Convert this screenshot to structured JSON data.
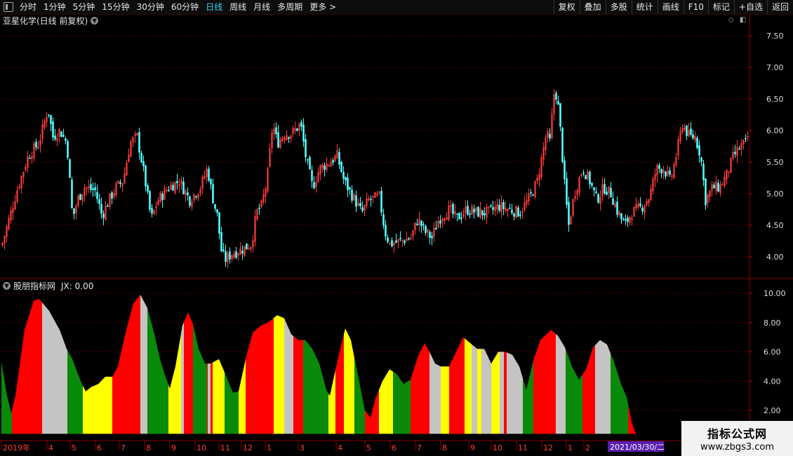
{
  "toolbar": {
    "left_items": [
      "分时",
      "1分钟",
      "5分钟",
      "15分钟",
      "30分钟",
      "60分钟",
      "日线",
      "周线",
      "月线",
      "多周期",
      "更多 >"
    ],
    "active": "日线",
    "right_items": [
      "复权",
      "叠加",
      "多股",
      "统计",
      "画线",
      "F10",
      "标记",
      "+自选",
      "返回"
    ]
  },
  "main_title": "亚星化学(日线 前复权)",
  "sub_title": "股朋指标网",
  "sub_value": "JX: 0.00",
  "price_axis": [
    "7.50",
    "7.00",
    "6.50",
    "6.00",
    "5.50",
    "5.00",
    "4.50",
    "4.00"
  ],
  "ind_axis": [
    "10.00",
    "8.00",
    "6.00",
    "4.00",
    "2.00"
  ],
  "date_labels": [
    "2019年",
    "4",
    "5",
    "6",
    "7",
    "8",
    "9",
    "10",
    "11",
    "12",
    "1",
    "3",
    "4",
    "5",
    "6",
    "7",
    "8",
    "9",
    "10",
    "11",
    "12",
    "1",
    "2",
    "3"
  ],
  "date_highlight": "2021/03/30/二",
  "watermark": {
    "title": "指标公式网",
    "url": "www.zbgs3.com"
  },
  "colors": {
    "up": "#ff3c3c",
    "down": "#54ffff",
    "green": "#0a8a0a",
    "red": "#ff0000",
    "yellow": "#ffff00",
    "gray": "#c4c4c4"
  }
}
